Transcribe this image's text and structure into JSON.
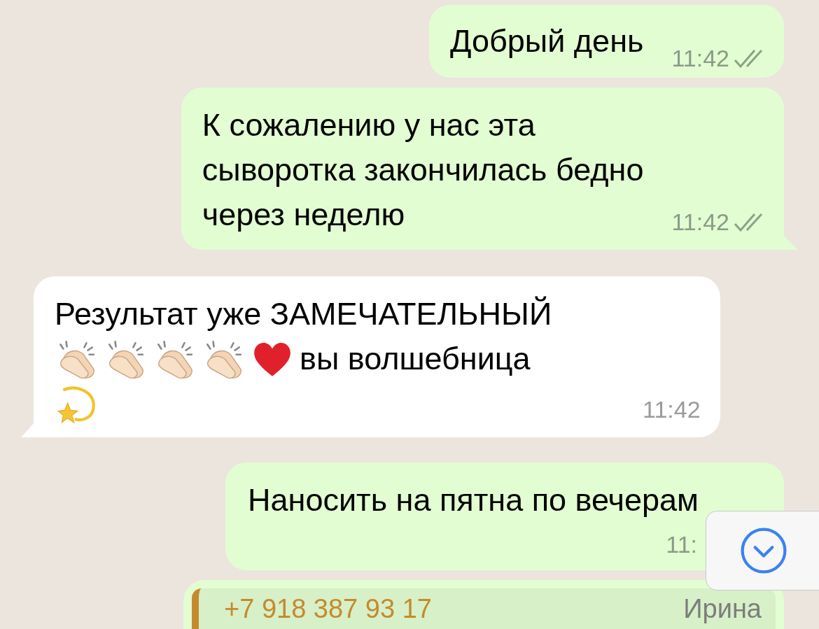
{
  "messages": [
    {
      "kind": "outgoing",
      "lines": [
        "Добрый день"
      ],
      "time": "11:42",
      "read": false,
      "tail": false
    },
    {
      "kind": "outgoing",
      "lines": [
        "К сожалению у нас эта",
        "сыворотка закончилась бедно",
        "через неделю"
      ],
      "time": "11:42",
      "read": false,
      "tail": true
    },
    {
      "kind": "incoming",
      "segments": [
        {
          "kind": "text",
          "text": "Результат уже ЗАМЕЧАТЕЛЬНЫЙ"
        },
        {
          "kind": "break"
        },
        {
          "kind": "clap"
        },
        {
          "kind": "clap"
        },
        {
          "kind": "clap"
        },
        {
          "kind": "clap"
        },
        {
          "kind": "heart"
        },
        {
          "kind": "text",
          "text": "вы волшебница"
        },
        {
          "kind": "break"
        },
        {
          "kind": "dizzy"
        }
      ],
      "time": "11:42",
      "tail": true
    },
    {
      "kind": "outgoing",
      "lines": [
        "Наносить на пятна по вечерам"
      ],
      "time": "11:"
    },
    {
      "kind": "outgoing",
      "quote": {
        "phone": "+7 918 387 93 17",
        "name": "Ирина"
      }
    }
  ],
  "scroll_down_button": {
    "visible": true
  }
}
